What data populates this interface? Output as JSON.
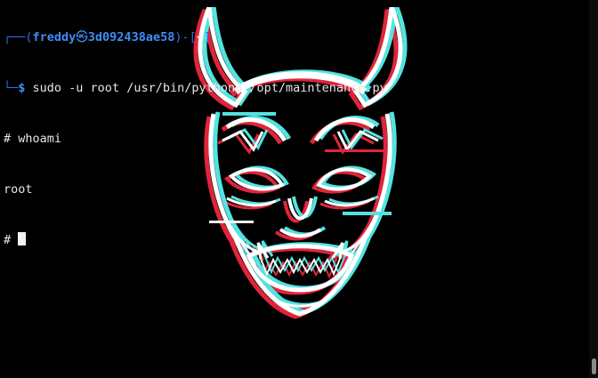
{
  "terminal": {
    "prompt": {
      "frame_top": "┌──(",
      "user": "freddy",
      "at_symbol": "㉿",
      "host": "3d092438ae58",
      "sep": ")-[",
      "cwd": "~",
      "close": "]",
      "frame_bottom": "└─",
      "dollar": "$",
      "command": " sudo -u root /usr/bin/python3 /opt/maintenance.py"
    },
    "lines": [
      "# whoami",
      "root"
    ],
    "root_prompt": "# "
  },
  "wallpaper": {
    "icon": "hannya-mask-icon",
    "colors": {
      "glitch_cyan": "#53e3e0",
      "glitch_red": "#e0243a",
      "face": "#ffffff"
    }
  }
}
